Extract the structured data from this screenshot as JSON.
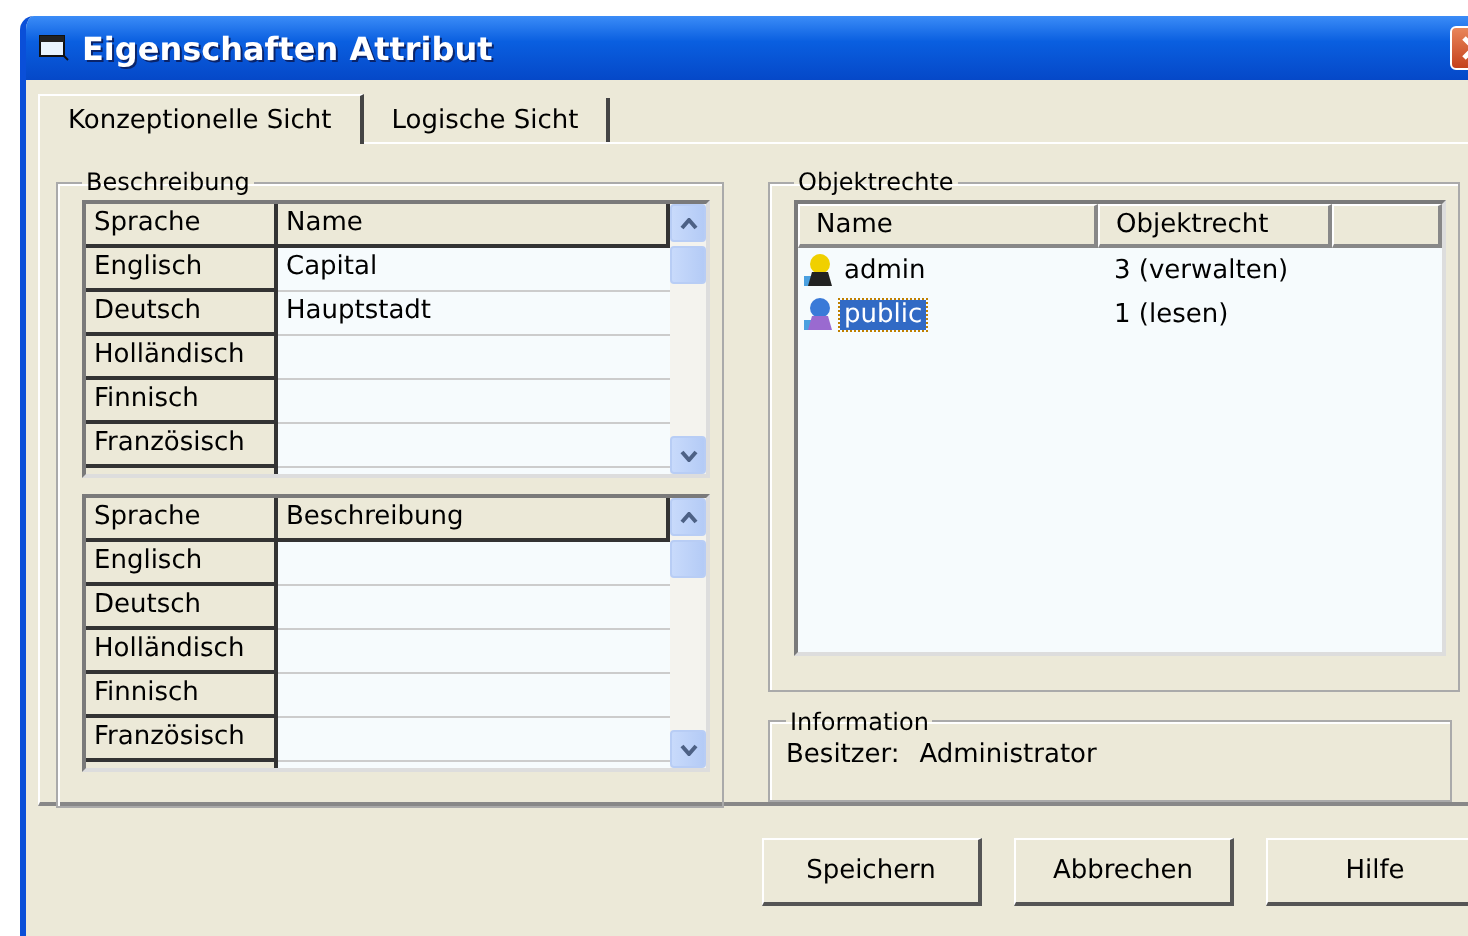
{
  "window": {
    "title": "Eigenschaften Attribut"
  },
  "tabs": [
    {
      "label": "Konzeptionelle Sicht",
      "selected": true
    },
    {
      "label": "Logische Sicht",
      "selected": false
    }
  ],
  "description_group": {
    "title": "Beschreibung",
    "grids": [
      {
        "columns": [
          "Sprache",
          "Name"
        ],
        "rows": [
          {
            "language": "Englisch",
            "value": "Capital"
          },
          {
            "language": "Deutsch",
            "value": "Hauptstadt"
          },
          {
            "language": "Holländisch"
          },
          {
            "language": "Finnisch"
          },
          {
            "language": "Französisch"
          }
        ]
      },
      {
        "columns": [
          "Sprache",
          "Beschreibung"
        ],
        "rows": [
          {
            "language": "Englisch"
          },
          {
            "language": "Deutsch"
          },
          {
            "language": "Holländisch"
          },
          {
            "language": "Finnisch"
          },
          {
            "language": "Französisch"
          }
        ]
      }
    ]
  },
  "rights_group": {
    "title": "Objektrechte",
    "columns": [
      "Name",
      "Objektrecht"
    ],
    "rows": [
      {
        "name": "admin",
        "right": "3 (verwalten)",
        "kind": "admin",
        "selected": false
      },
      {
        "name": "public",
        "right": "1 (lesen)",
        "kind": "group",
        "selected": true
      }
    ]
  },
  "information": {
    "title": "Information",
    "label": "Besitzer:",
    "value": "Administrator"
  },
  "buttons": [
    "Speichern",
    "Abbrechen",
    "Hilfe"
  ]
}
